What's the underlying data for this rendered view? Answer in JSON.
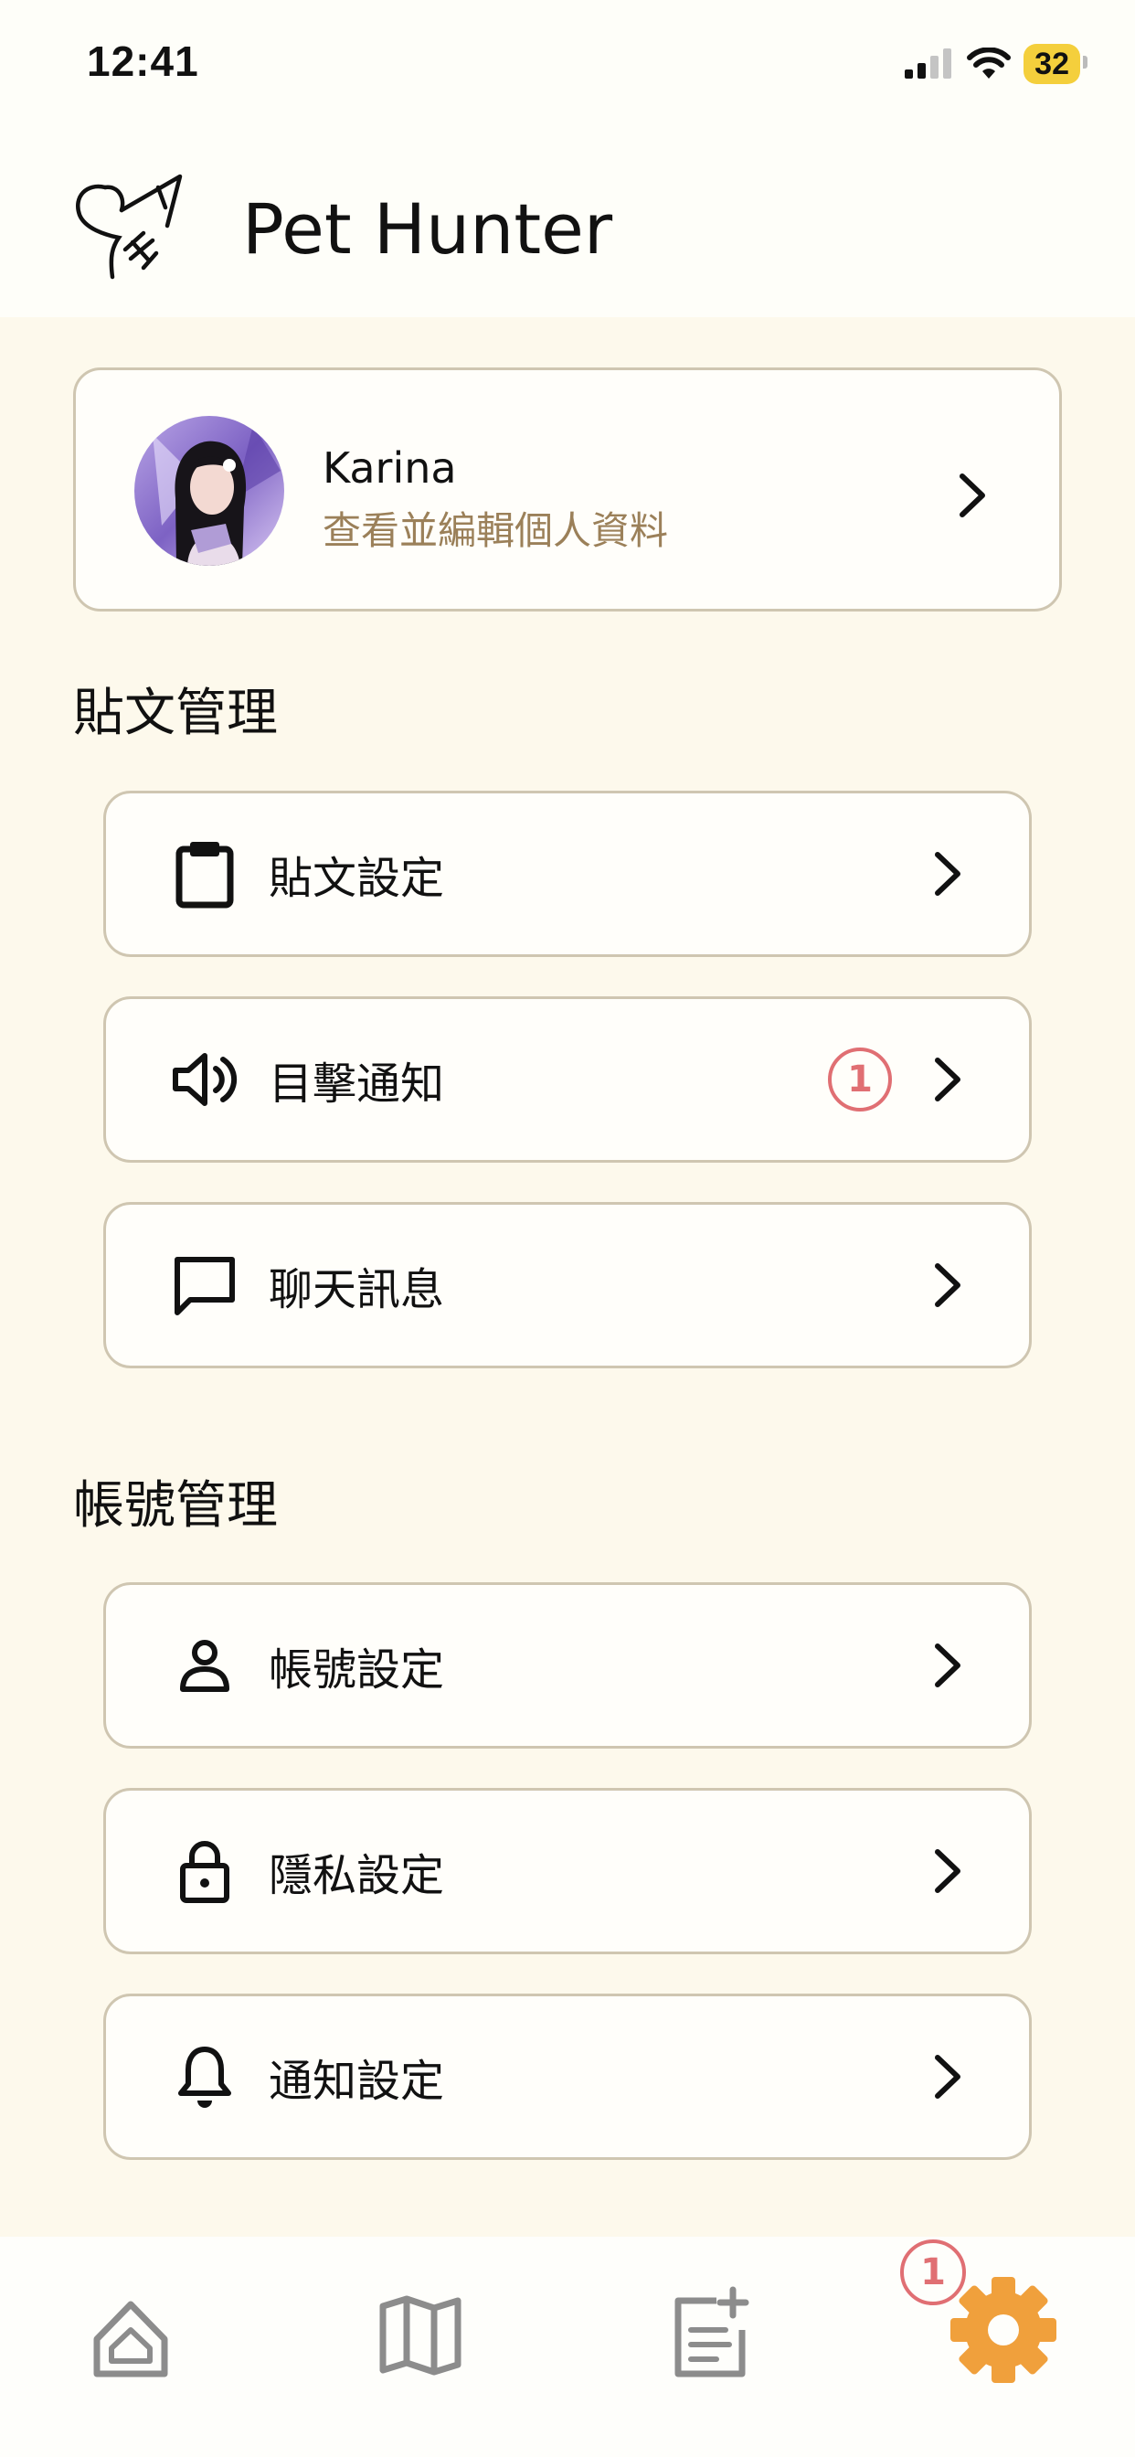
{
  "status_bar": {
    "time": "12:41",
    "battery": "32"
  },
  "header": {
    "app_title": "Pet Hunter"
  },
  "profile": {
    "name": "Karina",
    "subtitle": "查看並編輯個人資料"
  },
  "sections": {
    "posts": {
      "title": "貼文管理",
      "items": [
        {
          "label": "貼文設定",
          "icon": "clipboard-icon"
        },
        {
          "label": "目擊通知",
          "icon": "speaker-icon",
          "badge": "1"
        },
        {
          "label": "聊天訊息",
          "icon": "chat-icon"
        }
      ]
    },
    "account": {
      "title": "帳號管理",
      "items": [
        {
          "label": "帳號設定",
          "icon": "user-icon"
        },
        {
          "label": "隱私設定",
          "icon": "lock-icon"
        },
        {
          "label": "通知設定",
          "icon": "bell-icon"
        }
      ]
    }
  },
  "tabbar": {
    "tabs": [
      "home-icon",
      "map-icon",
      "post-add-icon",
      "settings-icon"
    ],
    "active": "settings-icon",
    "settings_badge": "1"
  },
  "colors": {
    "background": "#fdf9ec",
    "card_border": "#cfc6b1",
    "subtitle": "#9b8059",
    "badge": "#e06f73",
    "active_tab": "#f0a03c",
    "inactive_tab": "#8c8c8c"
  }
}
